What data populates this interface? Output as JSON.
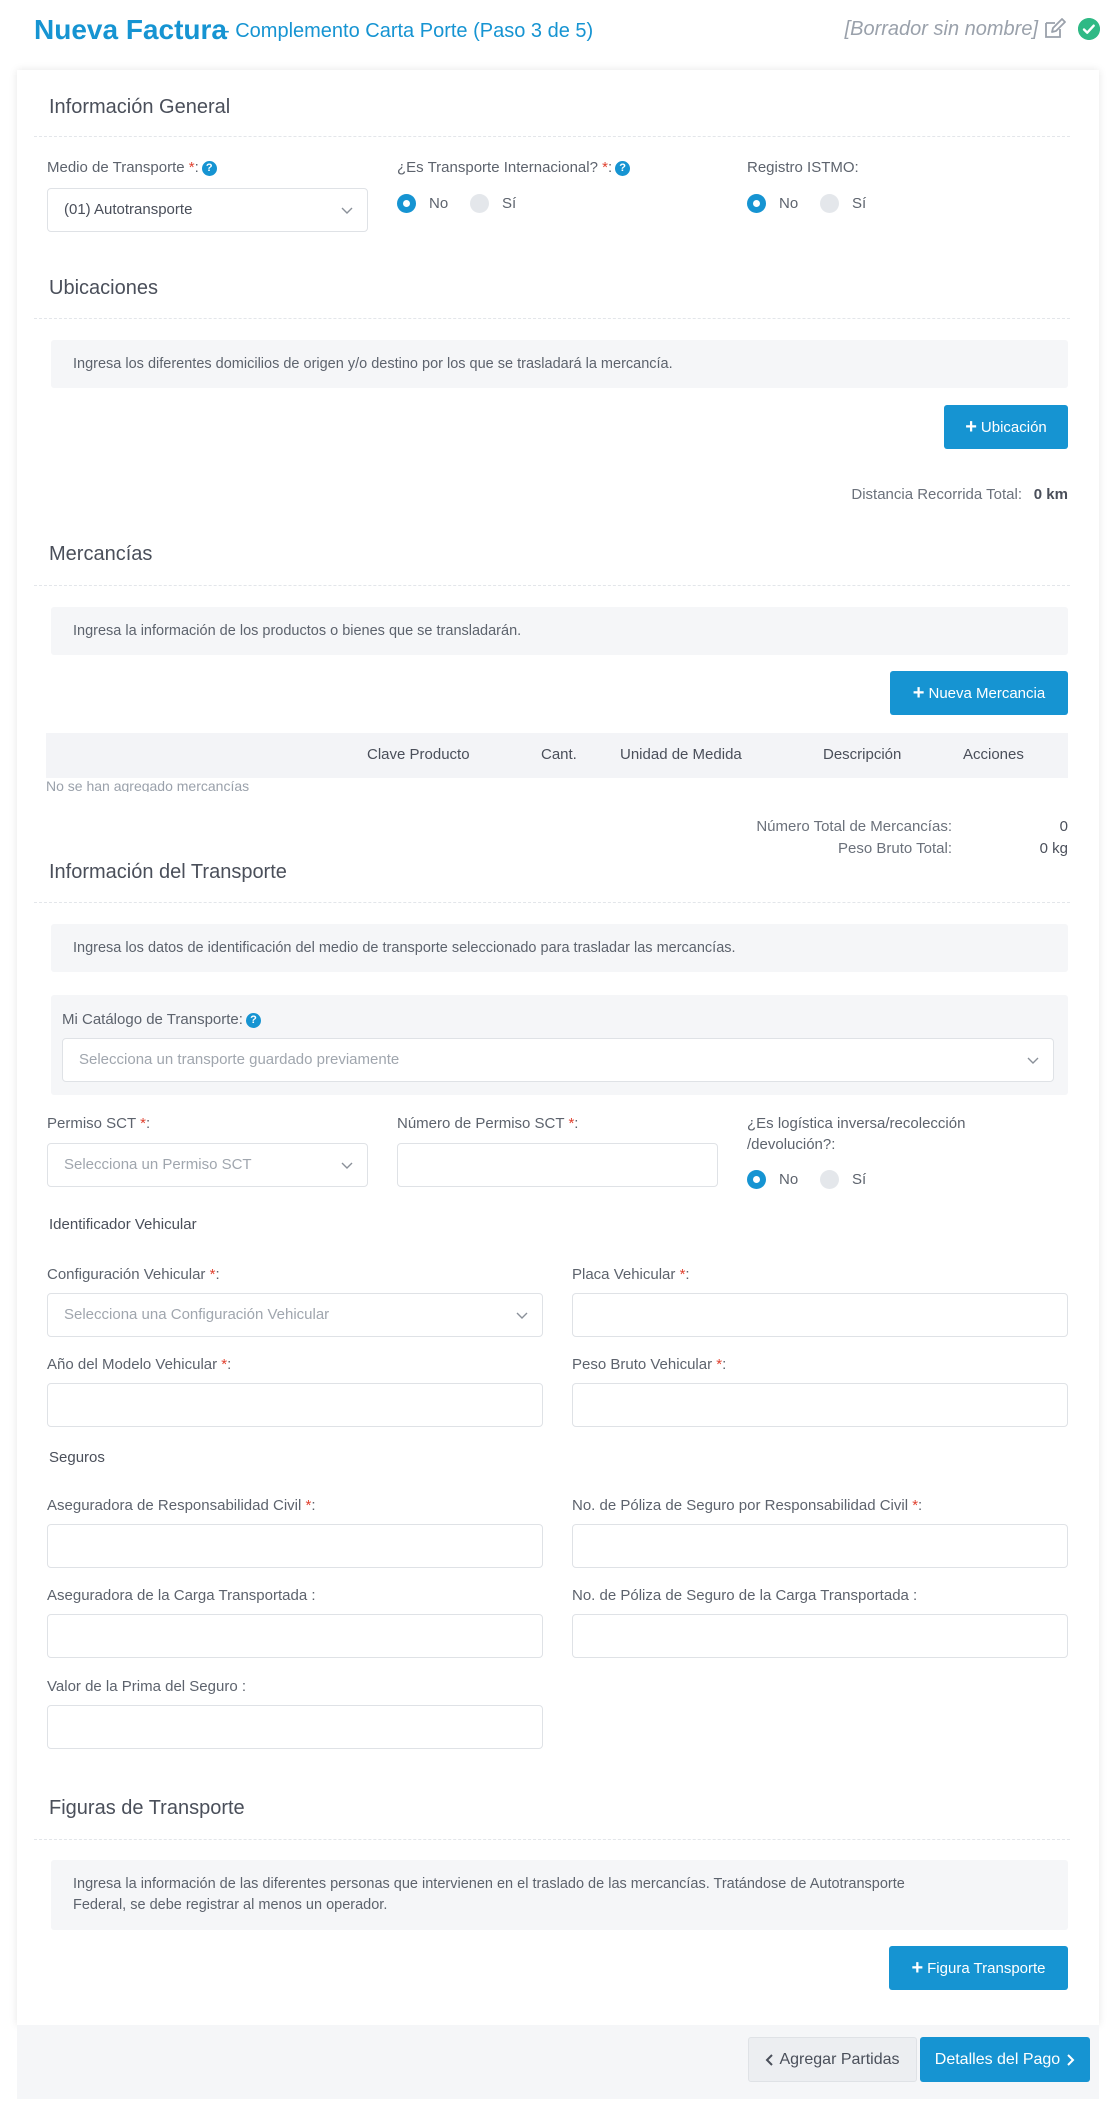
{
  "header": {
    "title": "Nueva Factura",
    "subtitle": "- Complemento Carta Porte (Paso 3 de 5)",
    "draft": "[Borrador sin nombre]",
    "accent": "#1694d2"
  },
  "general": {
    "title": "Información General",
    "medio_label": "Medio de Transporte",
    "medio_value": "(01) Autotransporte",
    "internacional_label": "¿Es Transporte Internacional?",
    "istmo_label": "Registro ISTMO:",
    "no": "No",
    "si": "Sí"
  },
  "ubicaciones": {
    "title": "Ubicaciones",
    "info": "Ingresa los diferentes domicilios de origen y/o destino por los que se trasladará la mercancía.",
    "button": "Ubicación",
    "distance_label": "Distancia Recorrida Total:",
    "distance_value": "0 km"
  },
  "mercancias": {
    "title": "Mercancías",
    "info": "Ingresa la información de los productos o bienes que se transladarán.",
    "button": "Nueva Mercancia",
    "columns": [
      "Clave Producto",
      "Cant.",
      "Unidad de Medida",
      "Descripción",
      "Acciones"
    ],
    "empty": "No se han agregado mercancías",
    "total_label": "Número Total de Mercancías:",
    "total_value": "0",
    "peso_label": "Peso Bruto Total:",
    "peso_value": "0 kg"
  },
  "transporte": {
    "title": "Información del Transporte",
    "info": "Ingresa los datos de identificación del medio de transporte seleccionado para trasladar las mercancías.",
    "catalogo_label": "Mi Catálogo de Transporte:",
    "catalogo_placeholder": "Selecciona un transporte guardado previamente",
    "permiso_label": "Permiso SCT",
    "permiso_placeholder": "Selecciona un Permiso SCT",
    "num_permiso_label": "Número de Permiso SCT",
    "logistica_label_1": "¿Es logística inversa/recolección",
    "logistica_label_2": "/devolución?:",
    "vehicular_title": "Identificador Vehicular",
    "config_label": "Configuración Vehicular",
    "config_placeholder": "Selecciona una Configuración Vehicular",
    "placa_label": "Placa Vehicular",
    "anio_label": "Año del Modelo Vehicular",
    "peso_vehicular_label": "Peso Bruto Vehicular",
    "seguros_title": "Seguros",
    "aseg_civil_label": "Aseguradora de Responsabilidad Civil",
    "poliza_civil_label": "No. de Póliza de Seguro por Responsabilidad Civil",
    "aseg_carga_label": "Aseguradora de la Carga Transportada :",
    "poliza_carga_label": "No. de Póliza de Seguro de la Carga Transportada :",
    "prima_label": "Valor de la Prima del Seguro :"
  },
  "figuras": {
    "title": "Figuras de Transporte",
    "info_1": "Ingresa la información de las diferentes personas que intervienen en el traslado de las mercancías. Tratándose de Autotransporte",
    "info_2": "Federal, se debe registrar al menos un operador.",
    "button": "Figura Transporte"
  },
  "footer": {
    "back": "Agregar Partidas",
    "next": "Detalles del Pago"
  }
}
